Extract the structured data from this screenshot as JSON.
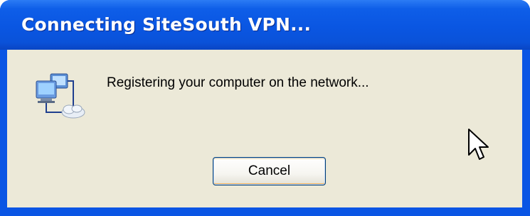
{
  "dialog": {
    "title": "Connecting SiteSouth VPN...",
    "message": "Registering your computer on the network...",
    "cancel_label": "Cancel",
    "icon": "network-connection-icon"
  },
  "cursor": {
    "icon": "mouse-pointer-icon"
  },
  "colors": {
    "titlebar": "#0a56e2",
    "frame": "#0a55e4",
    "client_background": "#ece9d8",
    "title_text": "#ffffff"
  }
}
